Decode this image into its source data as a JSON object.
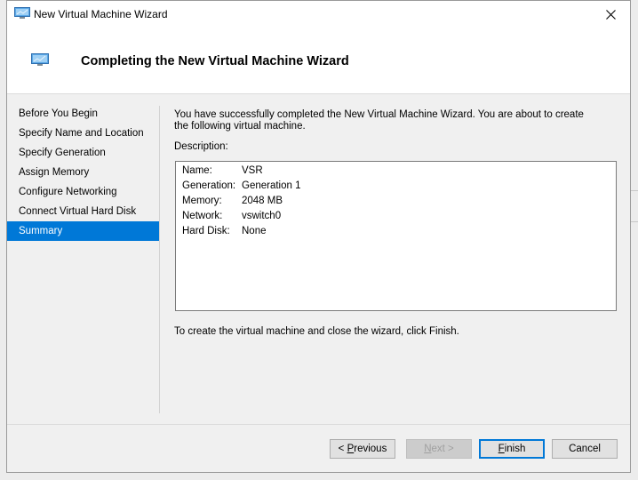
{
  "window": {
    "title": "New Virtual Machine Wizard",
    "app_icon": "monitor-icon",
    "close_icon": "close-icon"
  },
  "header": {
    "title": "Completing the New Virtual Machine Wizard",
    "icon": "monitor-icon"
  },
  "nav": {
    "items": [
      {
        "label": "Before You Begin"
      },
      {
        "label": "Specify Name and Location"
      },
      {
        "label": "Specify Generation"
      },
      {
        "label": "Assign Memory"
      },
      {
        "label": "Configure Networking"
      },
      {
        "label": "Connect Virtual Hard Disk"
      },
      {
        "label": "Summary"
      }
    ],
    "active_index": 6
  },
  "content": {
    "intro": "You have successfully completed the New Virtual Machine Wizard. You are about to create the following virtual machine.",
    "description_label": "Description:",
    "description": [
      {
        "key": "Name:",
        "value": "VSR"
      },
      {
        "key": "Generation:",
        "value": "Generation 1"
      },
      {
        "key": "Memory:",
        "value": "2048 MB"
      },
      {
        "key": "Network:",
        "value": "vswitch0"
      },
      {
        "key": "Hard Disk:",
        "value": "None"
      }
    ],
    "finish_note": "To create the virtual machine and close the wizard, click Finish."
  },
  "buttons": {
    "previous": {
      "prefix": "< ",
      "mnemonic": "P",
      "rest": "revious"
    },
    "next": {
      "mnemonic": "N",
      "rest": "ext >"
    },
    "finish": {
      "mnemonic": "F",
      "rest": "inish"
    },
    "cancel": "Cancel"
  },
  "colors": {
    "accent": "#0078d7",
    "dialog_bg": "#f0f0f0"
  }
}
